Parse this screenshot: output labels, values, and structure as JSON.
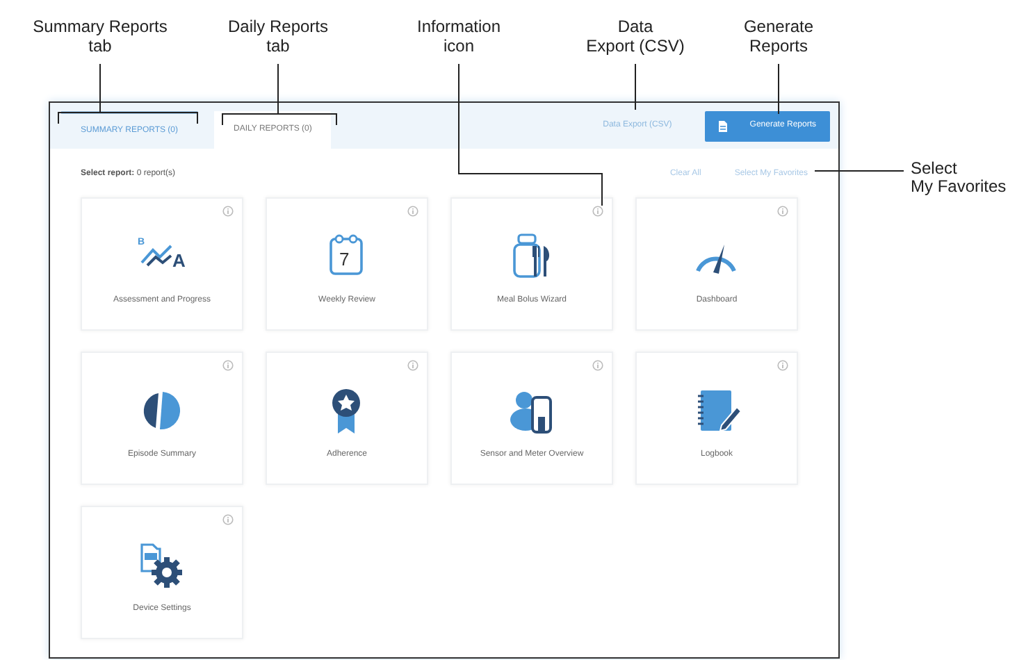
{
  "callouts": [
    {
      "kind": "tab-summary",
      "lines": [
        "Summary Reports",
        "tab"
      ]
    },
    {
      "kind": "tab-daily",
      "lines": [
        "Daily Reports",
        "tab"
      ]
    },
    {
      "kind": "info",
      "lines": [
        "Information",
        "icon"
      ]
    },
    {
      "kind": "export",
      "lines": [
        "Data",
        "Export (CSV)"
      ]
    },
    {
      "kind": "generate",
      "lines": [
        "Generate",
        "Reports"
      ]
    },
    {
      "kind": "favorites",
      "lines": [
        "Select",
        "My Favorites"
      ]
    }
  ],
  "tabs": [
    {
      "label": "SUMMARY REPORTS (0)",
      "selected": true
    },
    {
      "label": "DAILY REPORTS (0)",
      "selected": false
    }
  ],
  "data_export": "Data Export (CSV)",
  "generate_button": "Generate Reports",
  "selection": {
    "label": "Select report:",
    "count": "0 report(s)"
  },
  "clear_all": "Clear All",
  "select_favorites": "Select My Favorites",
  "reports": [
    {
      "title": "Assessment and Progress",
      "icon_letters": [
        "B",
        "A"
      ]
    },
    {
      "title": "Weekly Review",
      "icon_letters": [
        "7"
      ]
    },
    {
      "title": "Meal Bolus Wizard"
    },
    {
      "title": "Dashboard"
    },
    {
      "title": "Episode Summary"
    },
    {
      "title": "Adherence"
    },
    {
      "title": "Sensor and Meter Overview"
    },
    {
      "title": "Logbook"
    },
    {
      "title": "Device Settings"
    }
  ]
}
